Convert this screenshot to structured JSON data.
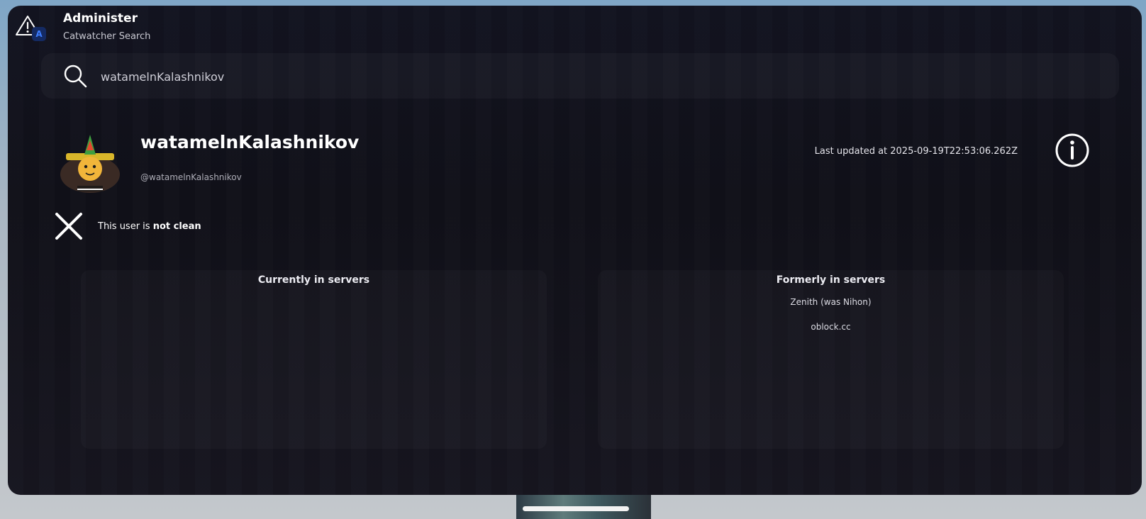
{
  "app": {
    "title": "Administer",
    "subtitle": "Catwatcher Search",
    "badge_letter": "A",
    "accent_color": "#3c7cff"
  },
  "search": {
    "value": "watamelnKalashnikov",
    "icon": "search-icon"
  },
  "profile": {
    "display_name": "watamelnKalashnikov",
    "username": "@watamelnKalashnikov",
    "last_updated": "Last updated at 2025-09-19T22:53:06.262Z",
    "info_icon": "info-icon"
  },
  "status": {
    "prefix": "This user is ",
    "verdict": "not clean",
    "icon": "x-icon"
  },
  "servers": {
    "current": {
      "title": "Currently in servers",
      "items": []
    },
    "former": {
      "title": "Formerly in servers",
      "items": [
        "Zenith (was Nihon)",
        "oblock.cc"
      ]
    }
  }
}
